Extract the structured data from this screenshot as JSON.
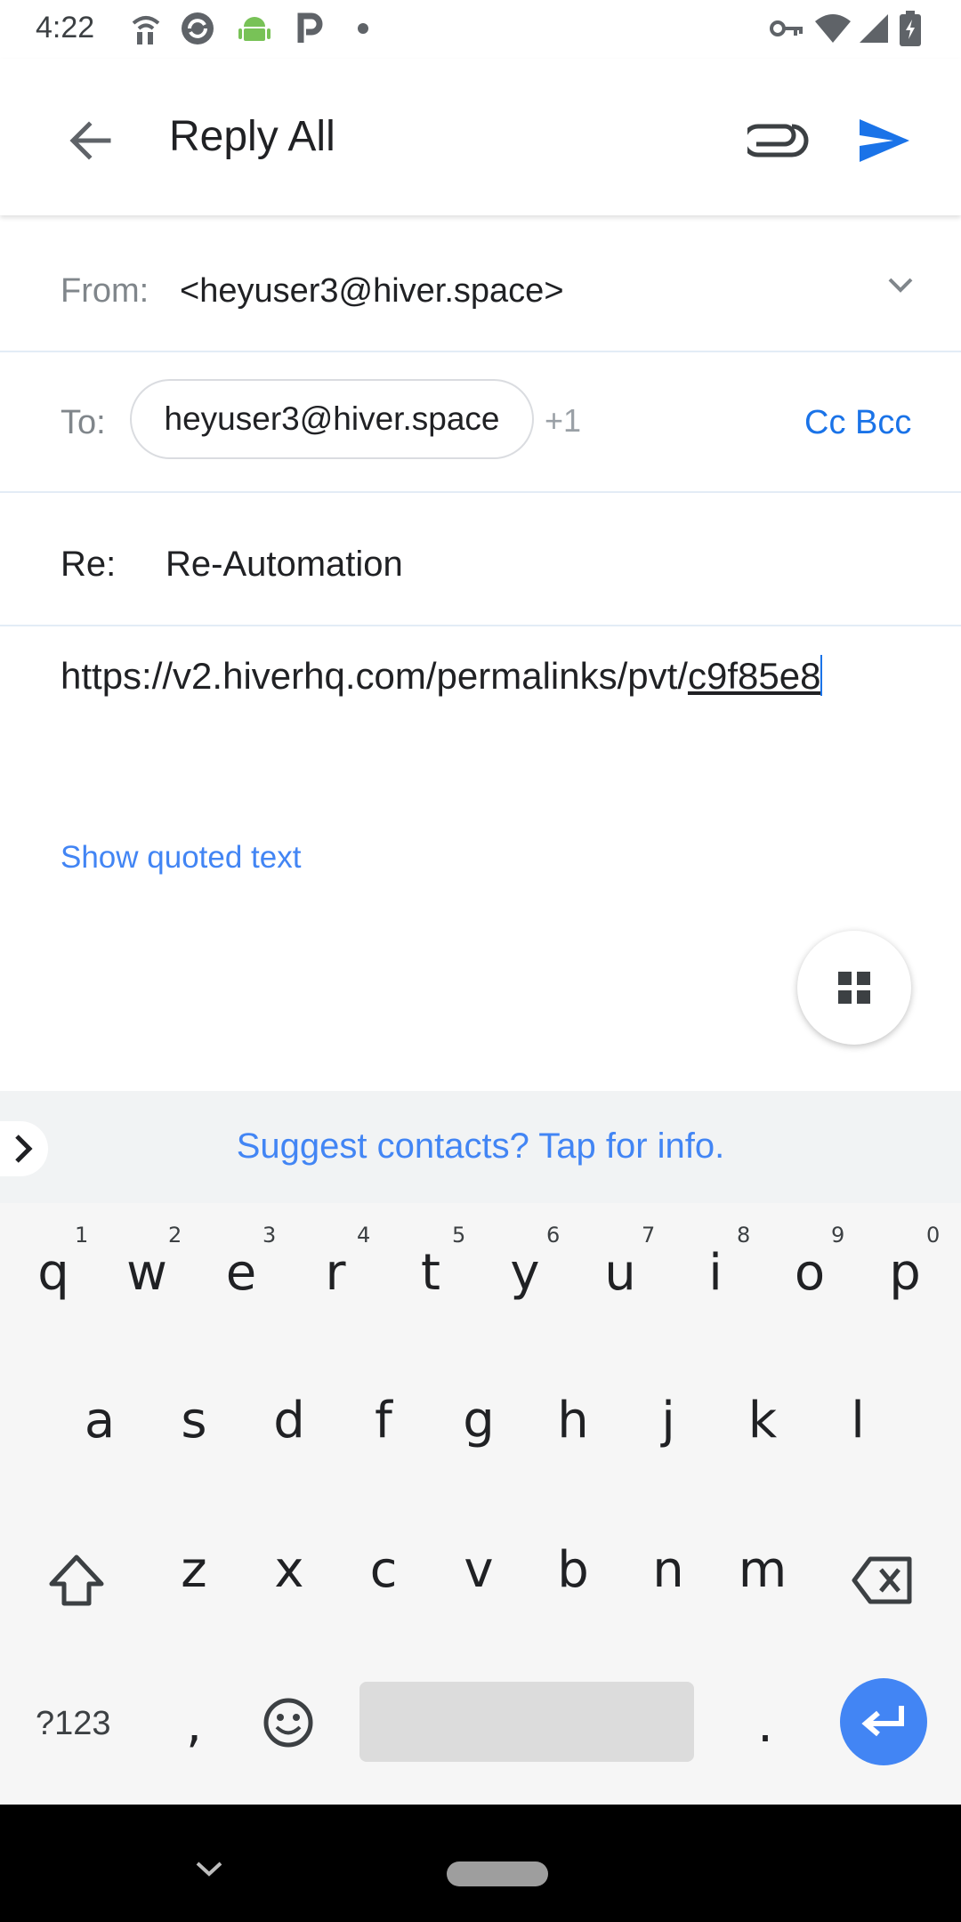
{
  "status_bar": {
    "time": "4:22",
    "icons": [
      "wifi-calling-icon",
      "sync-icon",
      "android-icon",
      "parking-icon",
      "dot-icon",
      "vpn-key-icon",
      "wifi-icon",
      "signal-icon",
      "battery-charging-icon"
    ]
  },
  "app_bar": {
    "title": "Reply All",
    "back_icon": "arrow-back-icon",
    "attach_icon": "paperclip-icon",
    "send_icon": "send-icon",
    "accent": "#1a73e8"
  },
  "compose": {
    "from_label": "From:",
    "from_value": "<heyuser3@hiver.space>",
    "to_label": "To:",
    "to_chip": "heyuser3@hiver.space",
    "to_more": "+1",
    "cc_bcc": "Cc Bcc",
    "subject_label": "Re:",
    "subject_value": "Re-Automation",
    "body_prefix": "https://v2.hiverhq.com/permalinks/pvt/",
    "body_underlined": "c9f85e8",
    "show_quoted": "Show quoted text",
    "fab_icon": "apps-grid-icon"
  },
  "suggestion_strip": {
    "text": "Suggest contacts? Tap for info."
  },
  "keyboard": {
    "row1": [
      "q",
      "w",
      "e",
      "r",
      "t",
      "y",
      "u",
      "i",
      "o",
      "p"
    ],
    "row1_hints": [
      "1",
      "2",
      "3",
      "4",
      "5",
      "6",
      "7",
      "8",
      "9",
      "0"
    ],
    "row2": [
      "a",
      "s",
      "d",
      "f",
      "g",
      "h",
      "j",
      "k",
      "l"
    ],
    "row3": [
      "z",
      "x",
      "c",
      "v",
      "b",
      "n",
      "m"
    ],
    "symbols_key": "?123",
    "comma": ",",
    "period": ".",
    "enter_color": "#4285f4"
  }
}
